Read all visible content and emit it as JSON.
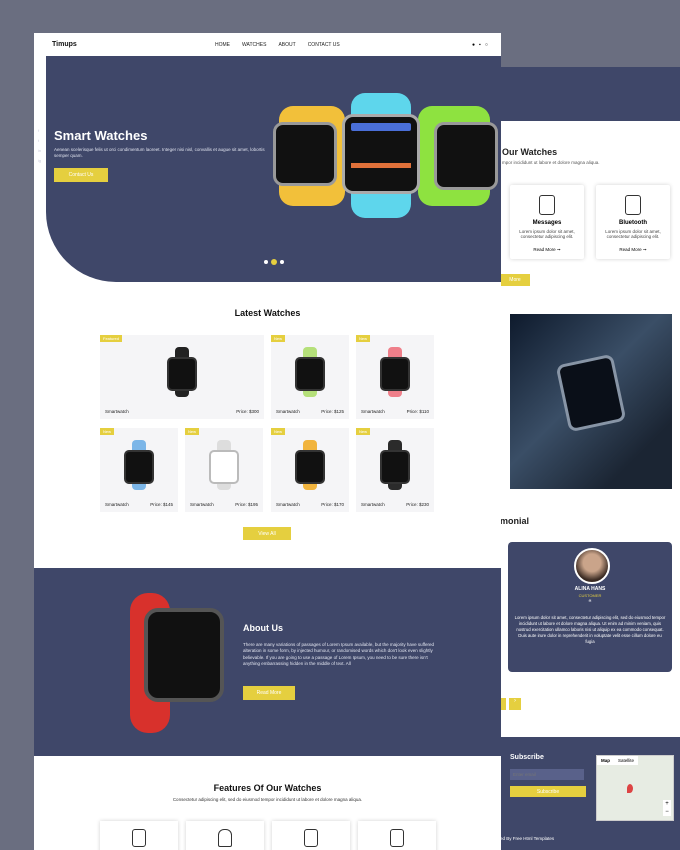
{
  "brand": "Timups",
  "nav": {
    "items": [
      "HOME",
      "WATCHES",
      "ABOUT",
      "CONTACT US"
    ]
  },
  "hero": {
    "title": "Smart Watches",
    "text": "Aenean scelerisque felis ut orci condimentum laoreet. Integer nisi nisl, convallis et augue sit amet, lobortis semper quam.",
    "button": "Contact Us",
    "socials": [
      "f",
      "t",
      "in",
      "ig"
    ]
  },
  "latest": {
    "title": "Latest Watches",
    "products": [
      {
        "tag": "Featured",
        "name": "Smartwatch",
        "price": "Price: $300",
        "strap": "#222222"
      },
      {
        "tag": "New",
        "name": "Smartwatch",
        "price": "Price: $125",
        "strap": "#b5e07a"
      },
      {
        "tag": "New",
        "name": "Smartwatch",
        "price": "Price: $110",
        "strap": "#ef7f8a"
      },
      {
        "tag": "New",
        "name": "Smartwatch",
        "price": "Price: $145",
        "strap": "#7cb6e8"
      },
      {
        "tag": "New",
        "name": "Smartwatch",
        "price": "Price: $195",
        "strap": "#dddddd"
      },
      {
        "tag": "New",
        "name": "Smartwatch",
        "price": "Price: $170",
        "strap": "#f1b43e"
      },
      {
        "tag": "New",
        "name": "Smartwatch",
        "price": "Price: $230",
        "strap": "#2b2b2b"
      }
    ],
    "view_all": "View All"
  },
  "about": {
    "title": "About Us",
    "text": "There are many variations of passages of Lorem Ipsum available, but the majority have suffered alteration in some form, by injected humour, or randomised words which don't look even slightly believable. If you are going to use a passage of Lorem Ipsum, you need to be sure there isn't anything embarrassing hidden in the middle of text. All",
    "button": "Read More"
  },
  "features": {
    "title": "Features Of Our Watches",
    "subtitle": "Consectetur adipiscing elit, sed do eiusmod tempor incididunt ut labore et dolore magna aliqua."
  },
  "back": {
    "features_title": "Our Watches",
    "features_sub": "mpor incididunt ut labore et dolore magna aliqua.",
    "cards": [
      {
        "title": "Messages",
        "text": "Lorem ipsum dolor sit amet, consectetur adipiscing elit.",
        "link": "Read More ➞"
      },
      {
        "title": "Bluetooth",
        "text": "Lorem ipsum dolor sit amet, consectetur adipiscing elit.",
        "link": "Read More ➞"
      }
    ],
    "more_btn": "More",
    "testimonial_title": "monial",
    "person": "ALINA HANS",
    "role": "CUSTOMER",
    "quote": "“",
    "testimonial_text": "Lorem ipsum dolor sit amet, consectetur adipiscing elit, sed do eiusmod tempor incididunt ut labore et dolore magna aliqua. Ut enim ad minim veniam, quis nostrud exercitation ullamco laboris nisi ut aliquip ex ea commodo consequat. Duis aute irure dolor in reprehenderit in voluptate velit esse cillum dolore eu fugia",
    "subscribe_title": "Subscribe",
    "email_placeholder": "Enter email",
    "subscribe_btn": "Subscribe",
    "map_tab": "Map",
    "satellite_tab": "Satellite",
    "footer": "ed By Free Html Templates"
  },
  "colors": {
    "navy": "#3f4769",
    "accent": "#e5cf3f"
  }
}
